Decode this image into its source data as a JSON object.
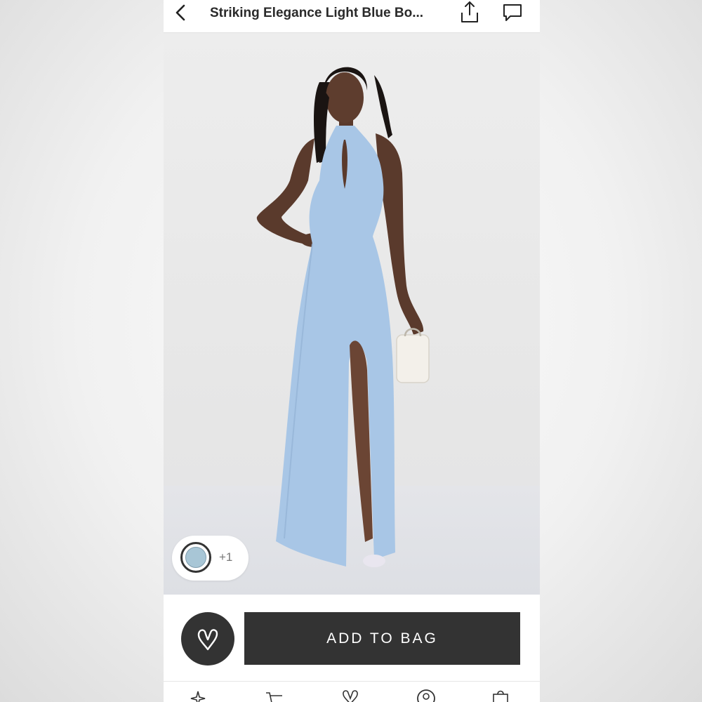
{
  "header": {
    "title": "Striking Elegance Light Blue Bo...",
    "back_icon": "chevron-left-icon",
    "share_icon": "share-icon",
    "chat_icon": "chat-bubble-icon"
  },
  "product": {
    "image_alt": "model-wearing-light-blue-halter-maxi-dress",
    "swatch_color": "#a8c6d6",
    "more_colors": "+1"
  },
  "actions": {
    "favorite_icon": "heart-icon",
    "add_to_bag_label": "ADD TO BAG"
  },
  "tabbar": {
    "items": [
      "sparkle-icon",
      "cart-icon",
      "heart-icon",
      "account-icon",
      "bag-icon"
    ]
  },
  "colors": {
    "dress": "#a8c6e6",
    "button_dark": "#333333",
    "accent_text": "#2a2a2a"
  }
}
